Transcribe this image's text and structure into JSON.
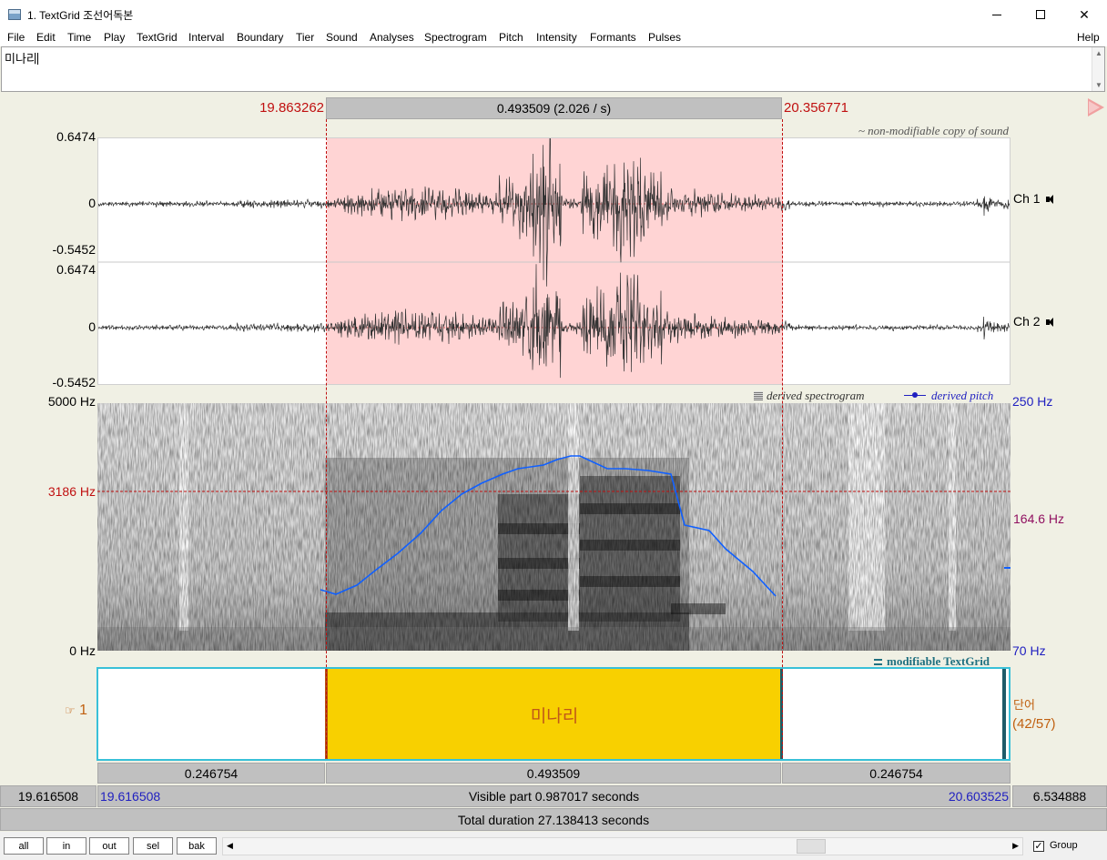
{
  "window": {
    "title": "1. TextGrid 조선어독본"
  },
  "menu": {
    "items": [
      "File",
      "Edit",
      "Time",
      "Play",
      "TextGrid",
      "Interval",
      "Boundary",
      "Tier",
      "Sound",
      "Analyses",
      "Spectrogram",
      "Pitch",
      "Intensity",
      "Formants",
      "Pulses"
    ],
    "help": "Help"
  },
  "text_entry": {
    "value": "미나리"
  },
  "selection": {
    "start": "19.863262",
    "end": "20.356771",
    "duration_label": "0.493509 (2.026 / s)"
  },
  "sound": {
    "caption": "~ non-modifiable copy of sound",
    "channels": [
      {
        "label": "Ch 1",
        "top": "0.6474",
        "zero": "0",
        "bottom": "-0.5452"
      },
      {
        "label": "Ch 2",
        "top": "0.6474",
        "zero": "0",
        "bottom": "-0.5452"
      }
    ]
  },
  "spectrogram": {
    "caption": "derived spectrogram",
    "freq_top": "5000 Hz",
    "freq_cursor": "3186 Hz",
    "freq_bottom": "0 Hz",
    "pitch_caption": "derived pitch",
    "pitch_top": "250 Hz",
    "pitch_mid": "164.6 Hz",
    "pitch_bottom": "70 Hz"
  },
  "textgrid": {
    "caption": "modifiable TextGrid",
    "tier_number": "1",
    "tier_name": "단어",
    "interval_count": "(42/57)",
    "interval_text": "미나리",
    "durations": [
      "0.246754",
      "0.493509",
      "0.246754"
    ]
  },
  "visible": {
    "left_window": "19.616508",
    "start": "19.616508",
    "label": "Visible part 0.987017 seconds",
    "end": "20.603525",
    "right_window": "6.534888"
  },
  "total": {
    "label": "Total duration 27.138413 seconds"
  },
  "buttons": {
    "all": "all",
    "in": "in",
    "out": "out",
    "sel": "sel",
    "bak": "bak"
  },
  "group": {
    "label": "Group",
    "checked": true
  },
  "colors": {
    "selection_fill": "#ffd4d4",
    "interval_fill": "#f8d000",
    "tier_border": "#38c0d8",
    "pitch_line": "#1060ff",
    "cursor": "#c01010"
  }
}
